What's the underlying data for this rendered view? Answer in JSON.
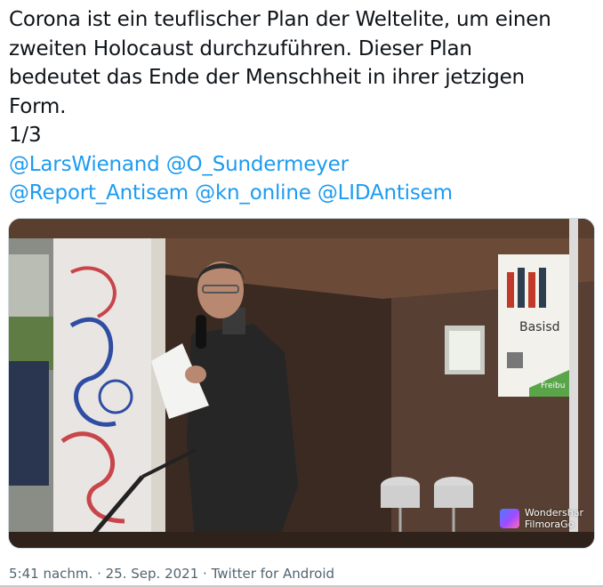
{
  "tweet": {
    "lines": [
      "Corona ist ein teuflischer Plan der Weltelite, um einen",
      "zweiten Holocaust durchzuführen. Dieser Plan",
      "bedeutet das Ende der Menschheit in ihrer jetzigen",
      "Form.",
      "1/3"
    ],
    "mentions_line1": [
      "@LarsWienand",
      "@O_Sundermeyer"
    ],
    "mentions_line2": [
      "@Report_Antisem",
      "@kn_online",
      "@LIDAntisem"
    ]
  },
  "media": {
    "banner_text": "Basisd",
    "banner_green_text": "Freibu",
    "watermark_line1": "Wondershar",
    "watermark_line2": "FilmoraGo"
  },
  "meta": {
    "time": "5:41 nachm.",
    "separator": "·",
    "date": "25. Sep. 2021",
    "source": "Twitter for Android"
  },
  "colors": {
    "text": "#0f1419",
    "link": "#1d9bf0",
    "meta": "#536471",
    "stage": "#3a2a22"
  }
}
